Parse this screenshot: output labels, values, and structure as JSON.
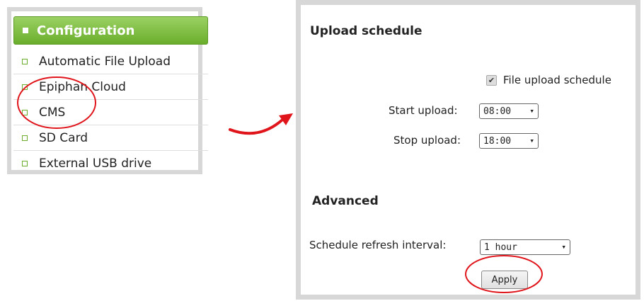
{
  "nav": {
    "header": "Configuration",
    "items": [
      {
        "label": "Automatic File Upload"
      },
      {
        "label": "Epiphan Cloud"
      },
      {
        "label": "CMS"
      },
      {
        "label": "SD Card"
      },
      {
        "label": "External USB drive"
      }
    ]
  },
  "upload_schedule": {
    "title": "Upload schedule",
    "checkbox_label": "File upload schedule",
    "checkbox_checked": true,
    "start_label": "Start upload:",
    "start_value": "08:00",
    "stop_label": "Stop upload:",
    "stop_value": "18:00"
  },
  "advanced": {
    "title": "Advanced",
    "refresh_label": "Schedule refresh interval:",
    "refresh_value": "1 hour",
    "apply_label": "Apply"
  },
  "colors": {
    "accent_green": "#6aae2c",
    "annotation_red": "#e0151b",
    "panel_border": "#d7d7d7"
  }
}
